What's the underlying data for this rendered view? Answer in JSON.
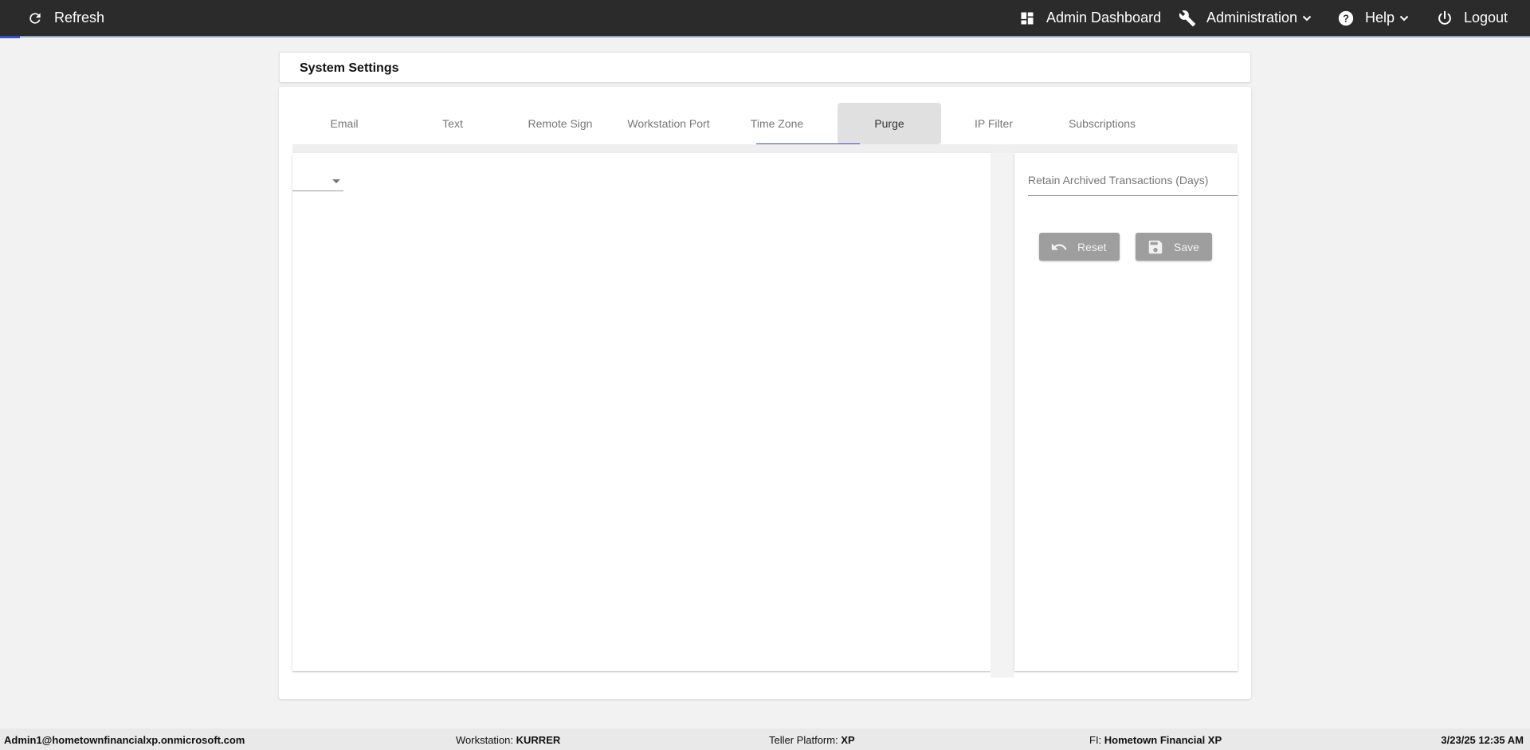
{
  "topbar": {
    "refresh_label": "Refresh",
    "admin_dashboard_label": "Admin Dashboard",
    "administration_label": "Administration",
    "help_label": "Help",
    "logout_label": "Logout",
    "background": "#2b2b2b",
    "accent": "#3a50c8"
  },
  "page": {
    "title": "System Settings"
  },
  "tabs": [
    {
      "label": "Email"
    },
    {
      "label": "Text"
    },
    {
      "label": "Remote Sign"
    },
    {
      "label": "Workstation Port"
    },
    {
      "label": "Time Zone",
      "selected": true
    },
    {
      "label": "Purge",
      "hovered": true
    },
    {
      "label": "IP Filter"
    },
    {
      "label": "Subscriptions"
    }
  ],
  "purge": {
    "select_value": "",
    "retain_label": "Retain Archived Transactions (Days)",
    "retain_value": "",
    "reset_label": "Reset",
    "save_label": "Save",
    "button_color": "#9e9e9e"
  },
  "footer": {
    "user": "Admin1@hometownfinancialxp.onmicrosoft.com",
    "workstation_label": "Workstation:",
    "workstation_value": "KURRER",
    "teller_label": "Teller Platform:",
    "teller_value": "XP",
    "fi_label": "FI:",
    "fi_value": "Hometown Financial XP",
    "datetime": "3/23/25 12:35 AM"
  }
}
